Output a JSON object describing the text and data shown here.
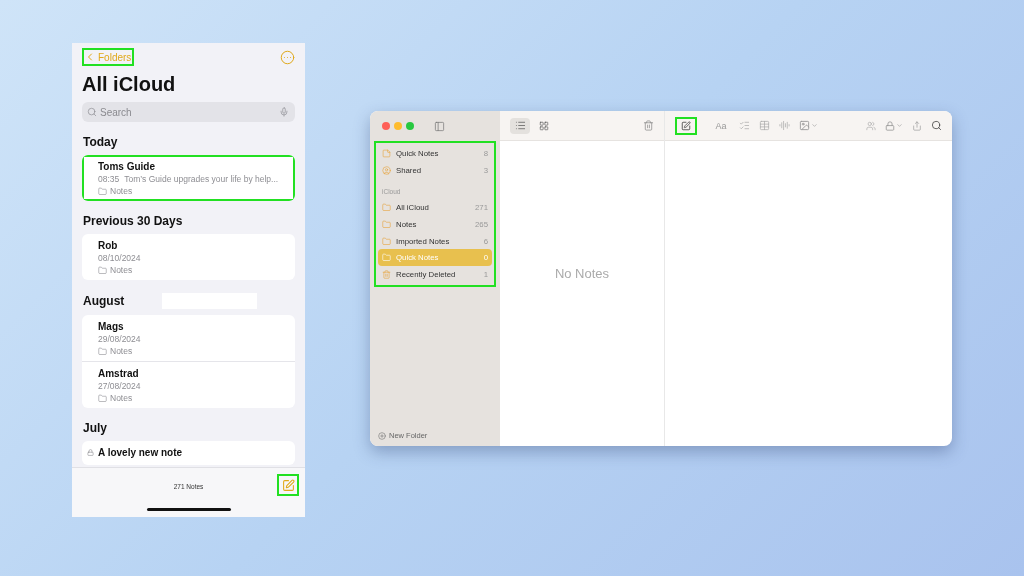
{
  "phone": {
    "back": {
      "label": "Folders",
      "highlighted": true
    },
    "title": "All iCloud",
    "search": {
      "placeholder": "Search"
    },
    "sections": [
      {
        "heading": "Today",
        "notes": [
          {
            "title": "Toms Guide",
            "time": "08:35",
            "preview": "Tom’s Guide upgrades your life by help...",
            "folder": "Notes",
            "highlighted": true,
            "locked": false
          }
        ]
      },
      {
        "heading": "Previous 30 Days",
        "notes": [
          {
            "title": "Rob",
            "time": "08/10/2024",
            "folder": "Notes",
            "highlighted": false,
            "locked": false
          }
        ]
      },
      {
        "heading": "August",
        "redacted": true,
        "notes": [
          {
            "title": "Mags",
            "time": "29/08/2024",
            "folder": "Notes",
            "highlighted": false,
            "locked": false
          },
          {
            "title": "Amstrad",
            "time": "27/08/2024",
            "folder": "Notes",
            "highlighted": false,
            "locked": false
          }
        ]
      },
      {
        "heading": "July",
        "notes": [
          {
            "title": "A lovely new note",
            "highlighted": false,
            "locked": true
          }
        ]
      }
    ],
    "footer": {
      "count": "271 Notes",
      "compose_highlighted": true
    }
  },
  "mac": {
    "view": [
      {
        "kind": "list",
        "selected": true
      },
      {
        "kind": "grid",
        "selected": false
      }
    ],
    "toolbar": {
      "compose_highlighted": true,
      "format": "Aa"
    },
    "sidebar": {
      "highlighted": true,
      "pinned": [
        {
          "label": "Quick Notes",
          "count": "8",
          "kind": "quick",
          "selected": false
        },
        {
          "label": "Shared",
          "count": "3",
          "kind": "shared",
          "selected": false
        }
      ],
      "group": "iCloud",
      "folders": [
        {
          "label": "All iCloud",
          "count": "271",
          "kind": "folder",
          "selected": false
        },
        {
          "label": "Notes",
          "count": "265",
          "kind": "folder",
          "selected": false
        },
        {
          "label": "Imported Notes",
          "count": "6",
          "kind": "folder",
          "selected": false
        },
        {
          "label": "Quick Notes",
          "count": "0",
          "kind": "folder",
          "selected": true
        },
        {
          "label": "Recently Deleted",
          "count": "1",
          "kind": "trash",
          "selected": false
        }
      ],
      "new_folder": "New Folder"
    },
    "list": {
      "empty": "No Notes"
    }
  }
}
